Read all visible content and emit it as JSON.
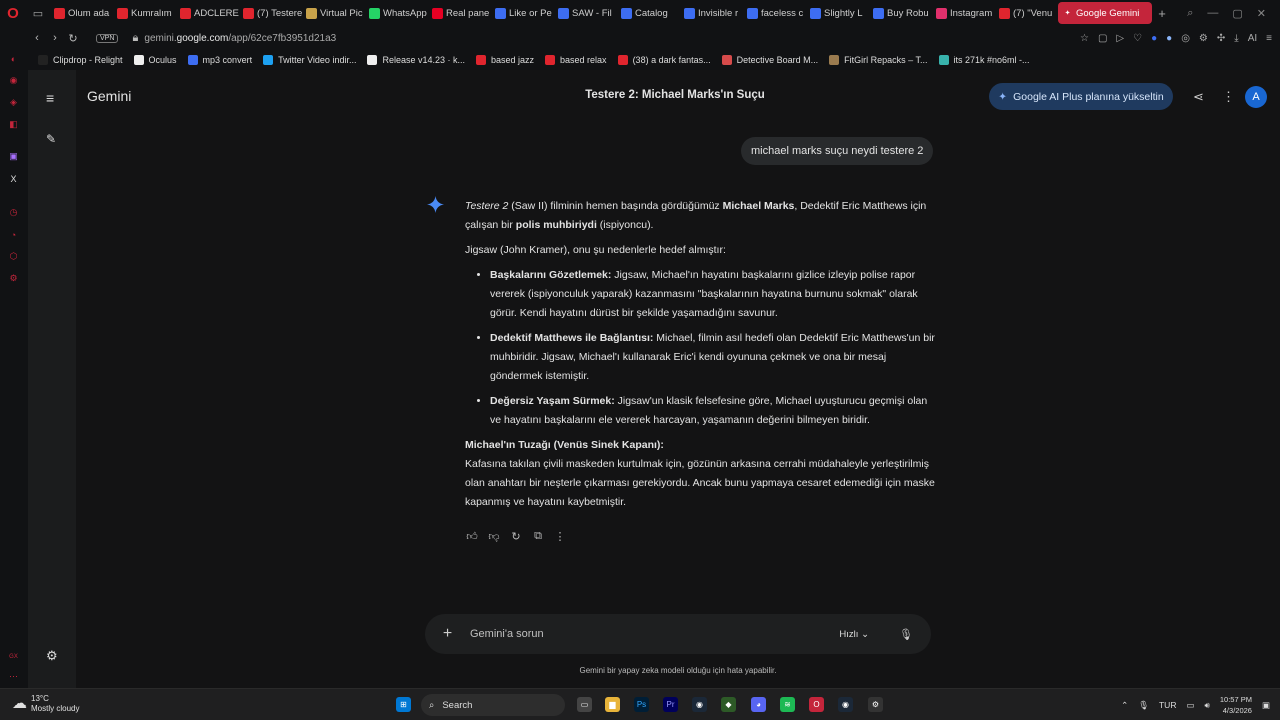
{
  "browser": {
    "tabs": [
      {
        "label": "Olum ada",
        "icon": "youtube-icon",
        "color": "#e0252e"
      },
      {
        "label": "Kumralım",
        "icon": "youtube-icon",
        "color": "#e0252e"
      },
      {
        "label": "ADCLERE",
        "icon": "youtube-icon",
        "color": "#e0252e"
      },
      {
        "label": "(7) Testere",
        "icon": "youtube-icon",
        "color": "#e0252e"
      },
      {
        "label": "Virtual Pic",
        "icon": "virtual-icon",
        "color": "#c8a24a"
      },
      {
        "label": "WhatsApp",
        "icon": "whatsapp-icon",
        "color": "#25d366"
      },
      {
        "label": "Real pane",
        "icon": "pinterest-icon",
        "color": "#e60023"
      },
      {
        "label": "Like or Pe",
        "icon": "page-icon",
        "color": "#3d6df2"
      },
      {
        "label": "SAW - Fil",
        "icon": "page-icon",
        "color": "#3d6df2"
      },
      {
        "label": "Catalog",
        "icon": "page-icon",
        "color": "#3d6df2"
      },
      {
        "label": "Invisible r",
        "icon": "page-icon",
        "color": "#3d6df2"
      },
      {
        "label": "faceless c",
        "icon": "page-icon",
        "color": "#3d6df2"
      },
      {
        "label": "Slightly L",
        "icon": "page-icon",
        "color": "#3d6df2"
      },
      {
        "label": "Buy Robu",
        "icon": "page-icon",
        "color": "#3d6df2"
      },
      {
        "label": "Instagram",
        "icon": "instagram-icon",
        "color": "#e1306c"
      },
      {
        "label": "(7) \"Venu",
        "icon": "youtube-icon",
        "color": "#e0252e"
      },
      {
        "label": "Google Gemini",
        "icon": "gemini-icon",
        "color": "#ffffff",
        "active": true
      }
    ],
    "url_prefix": "gemini.",
    "url_domain": "google.com",
    "url_path": "/app/62ce7fb3951d21a3",
    "vpn_label": "VPN",
    "bookmarks": [
      {
        "label": "Clipdrop - Relight",
        "color": "#222"
      },
      {
        "label": "Oculus",
        "color": "#eee"
      },
      {
        "label": "mp3 convert",
        "color": "#3d6df2"
      },
      {
        "label": "Twitter Video indir...",
        "color": "#1da1f2"
      },
      {
        "label": "Release v14.23 · k...",
        "color": "#eee"
      },
      {
        "label": "based jazz",
        "color": "#e0252e"
      },
      {
        "label": "based relax",
        "color": "#e0252e"
      },
      {
        "label": "(38) a dark fantas...",
        "color": "#e0252e"
      },
      {
        "label": "Detective Board M...",
        "color": "#d64b4b"
      },
      {
        "label": "FitGirl Repacks – T...",
        "color": "#9a7b4f"
      },
      {
        "label": "its 271k #no6ml -...",
        "color": "#38b2ac"
      }
    ]
  },
  "app": {
    "name": "Gemini",
    "chat_title": "Testere 2: Michael Marks'ın Suçu",
    "upgrade_label": "Google AI Plus planına yükseltin",
    "avatar_letter": "A",
    "user_message": "michael marks suçu neydi testere 2",
    "answer": {
      "intro_italic": "Testere 2",
      "intro_1": " (Saw II) filminin hemen başında gördüğümüz ",
      "intro_bold_1": "Michael Marks",
      "intro_2": ", Dedektif Eric Matthews için çalışan bir ",
      "intro_bold_2": "polis muhbiriydi",
      "intro_3": " (ispiyoncu).",
      "lead": "Jigsaw (John Kramer), onu şu nedenlerle hedef almıştır:",
      "bullets": [
        {
          "title": "Başkalarını Gözetlemek:",
          "text": " Jigsaw, Michael'ın hayatını başkalarını gizlice izleyip polise rapor vererek (ispiyonculuk yaparak) kazanmasını \"başkalarının hayatına burnunu sokmak\" olarak görür. Kendi hayatını dürüst bir şekilde yaşamadığını savunur."
        },
        {
          "title": "Dedektif Matthews ile Bağlantısı:",
          "text": " Michael, filmin asıl hedefi olan Dedektif Eric Matthews'un bir muhbiridir. Jigsaw, Michael'ı kullanarak Eric'i kendi oyununa çekmek ve ona bir mesaj göndermek istemiştir."
        },
        {
          "title": "Değersiz Yaşam Sürmek:",
          "text": " Jigsaw'un klasik felsefesine göre, Michael uyuşturucu geçmişi olan ve hayatını başkalarını ele vererek harcayan, yaşamanın değerini bilmeyen biridir."
        }
      ],
      "trap_title": "Michael'ın Tuzağı (Venüs Sinek Kapanı):",
      "trap_text": "Kafasına takılan çivili maskeden kurtulmak için, gözünün arkasına cerrahi müdahaleyle yerleştirilmiş olan anahtarı bir neşterle çıkarması gerekiyordu. Ancak bunu yapmaya cesaret edemediği için maske kapanmış ve hayatını kaybetmiştir."
    },
    "input_placeholder": "Gemini'a sorun",
    "mode_label": "Hızlı",
    "disclaimer": "Gemini bir yapay zeka modeli olduğu için hata yapabilir."
  },
  "taskbar": {
    "temperature": "13°C",
    "weather": "Mostly cloudy",
    "search_label": "Search",
    "language": "TUR",
    "time": "10:57 PM",
    "date": "4/3/2026"
  },
  "colors": {
    "accent": "#c4253b",
    "upgrade_bg": "#1f3a5f",
    "avatar_bg": "#1967d2"
  }
}
